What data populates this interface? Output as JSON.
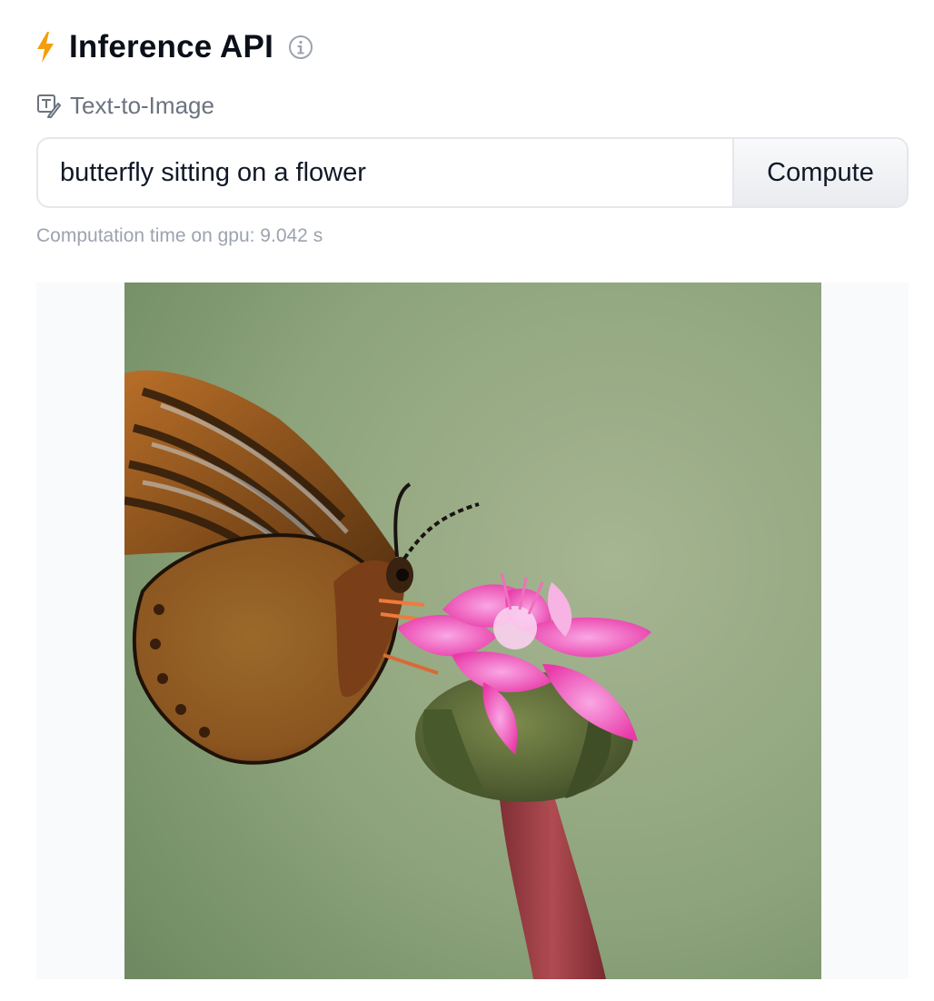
{
  "widget": {
    "title": "Inference API",
    "title_icon": "lightning-bolt-icon",
    "info_icon": "info-icon",
    "accent_color": "#f59e0b"
  },
  "task": {
    "icon": "text-to-image-icon",
    "label": "Text-to-Image"
  },
  "prompt": {
    "value": "butterfly sitting on a flower"
  },
  "compute_button": {
    "label": "Compute"
  },
  "computation_time": "Computation time on gpu: 9.042 s",
  "output": {
    "subject_icon": "generated-image"
  }
}
